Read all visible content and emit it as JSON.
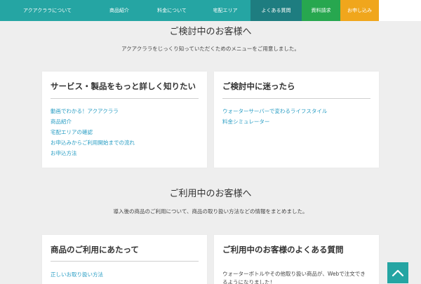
{
  "nav": {
    "items": [
      {
        "label": "アクアクララについて"
      },
      {
        "label": "商品紹介"
      },
      {
        "label": "料金について"
      },
      {
        "label": "宅配エリア"
      },
      {
        "label": "よくある質問"
      },
      {
        "label": "資料請求"
      },
      {
        "label": "お申し込み"
      }
    ]
  },
  "colors": {
    "nav_bg": "#25a5a3",
    "nav_active": "#1e7d80",
    "request_bg": "#27a74f",
    "apply_bg": "#f0a61c",
    "link": "#2a9ec4"
  },
  "section1": {
    "title": "ご検討中のお客様へ",
    "desc": "アクアクララをじっくり知っていただくためのメニューをご用意しました。",
    "cards": [
      {
        "title": "サービス・製品をもっと詳しく知りたい",
        "links": [
          "動画でわかる！アクアクララ",
          "商品紹介",
          "宅配エリアの確認",
          "お申込みからご利用開始までの流れ",
          "お申込方法"
        ]
      },
      {
        "title": "ご検討中に迷ったら",
        "links": [
          "ウォーターサーバーで変わるライフスタイル",
          "料金シミュレーター"
        ]
      }
    ]
  },
  "section2": {
    "title": "ご利用中のお客様へ",
    "desc": "導入後の商品のご利用について、商品の取り扱い方法などの情報をまとめました。",
    "cards": [
      {
        "title": "商品のご利用にあたって",
        "links": [
          "正しいお取り扱い方法"
        ]
      },
      {
        "title": "ご利用中のお客様のよくある質問",
        "text": "ウォーターボトルやその他取り扱い商品が、Webで注文できるようになりました！"
      }
    ]
  },
  "to_top": {
    "icon": "chevron-up-icon"
  }
}
